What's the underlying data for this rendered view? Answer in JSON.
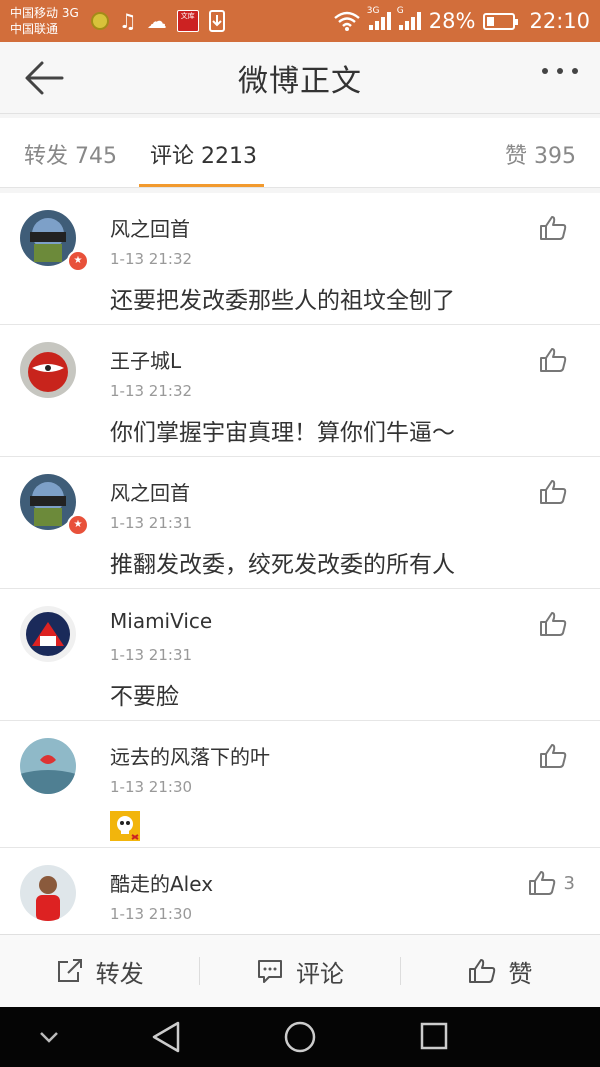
{
  "status_bar": {
    "carrier_line1": "中国移动 3G",
    "carrier_line2": "中国联通",
    "notif_red_text": "文库",
    "sim1_type": "3G",
    "sim2_type": "G",
    "battery": "28%",
    "time": "22:10"
  },
  "header": {
    "title": "微博正文"
  },
  "tabs": {
    "repost": "转发 745",
    "comment": "评论 2213",
    "like": "赞 395"
  },
  "comments": [
    {
      "name": "风之回首",
      "time": "1-13 21:32",
      "text": "还要把发改委那些人的祖坟全刨了",
      "likes": "",
      "verified": true
    },
    {
      "name": "王子城L",
      "time": "1-13 21:32",
      "text": "你们掌握宇宙真理！算你们牛逼～",
      "likes": "",
      "verified": false
    },
    {
      "name": "风之回首",
      "time": "1-13 21:31",
      "text": "推翻发改委，绞死发改委的所有人",
      "likes": "",
      "verified": true
    },
    {
      "name": "MiamiVice",
      "time": "1-13 21:31",
      "text": "不要脸",
      "likes": "",
      "verified": false
    },
    {
      "name": "远去的风落下的叶",
      "time": "1-13 21:30",
      "text": "",
      "likes": "",
      "verified": false,
      "sticker": "skull-emoji"
    },
    {
      "name": "酷走的Alex",
      "time": "1-13 21:30",
      "text": "",
      "likes": "3",
      "verified": false
    }
  ],
  "action_bar": {
    "repost": "转发",
    "comment": "评论",
    "like": "赞"
  },
  "colors": {
    "status_bar": "#d26e3b",
    "tab_underline": "#f29a2e",
    "verified_badge": "#e8513a"
  }
}
